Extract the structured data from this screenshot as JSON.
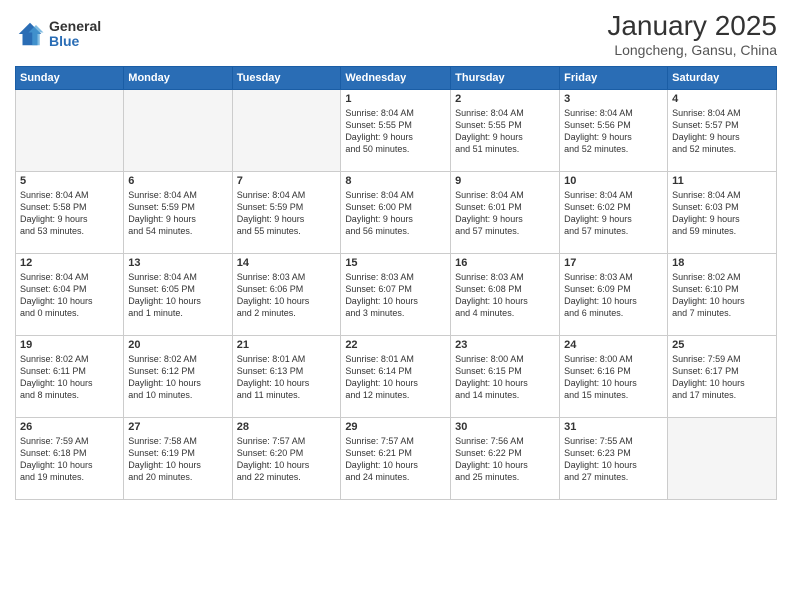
{
  "logo": {
    "general": "General",
    "blue": "Blue"
  },
  "header": {
    "month": "January 2025",
    "location": "Longcheng, Gansu, China"
  },
  "weekdays": [
    "Sunday",
    "Monday",
    "Tuesday",
    "Wednesday",
    "Thursday",
    "Friday",
    "Saturday"
  ],
  "weeks": [
    [
      {
        "num": "",
        "info": ""
      },
      {
        "num": "",
        "info": ""
      },
      {
        "num": "",
        "info": ""
      },
      {
        "num": "1",
        "info": "Sunrise: 8:04 AM\nSunset: 5:55 PM\nDaylight: 9 hours\nand 50 minutes."
      },
      {
        "num": "2",
        "info": "Sunrise: 8:04 AM\nSunset: 5:55 PM\nDaylight: 9 hours\nand 51 minutes."
      },
      {
        "num": "3",
        "info": "Sunrise: 8:04 AM\nSunset: 5:56 PM\nDaylight: 9 hours\nand 52 minutes."
      },
      {
        "num": "4",
        "info": "Sunrise: 8:04 AM\nSunset: 5:57 PM\nDaylight: 9 hours\nand 52 minutes."
      }
    ],
    [
      {
        "num": "5",
        "info": "Sunrise: 8:04 AM\nSunset: 5:58 PM\nDaylight: 9 hours\nand 53 minutes."
      },
      {
        "num": "6",
        "info": "Sunrise: 8:04 AM\nSunset: 5:59 PM\nDaylight: 9 hours\nand 54 minutes."
      },
      {
        "num": "7",
        "info": "Sunrise: 8:04 AM\nSunset: 5:59 PM\nDaylight: 9 hours\nand 55 minutes."
      },
      {
        "num": "8",
        "info": "Sunrise: 8:04 AM\nSunset: 6:00 PM\nDaylight: 9 hours\nand 56 minutes."
      },
      {
        "num": "9",
        "info": "Sunrise: 8:04 AM\nSunset: 6:01 PM\nDaylight: 9 hours\nand 57 minutes."
      },
      {
        "num": "10",
        "info": "Sunrise: 8:04 AM\nSunset: 6:02 PM\nDaylight: 9 hours\nand 57 minutes."
      },
      {
        "num": "11",
        "info": "Sunrise: 8:04 AM\nSunset: 6:03 PM\nDaylight: 9 hours\nand 59 minutes."
      }
    ],
    [
      {
        "num": "12",
        "info": "Sunrise: 8:04 AM\nSunset: 6:04 PM\nDaylight: 10 hours\nand 0 minutes."
      },
      {
        "num": "13",
        "info": "Sunrise: 8:04 AM\nSunset: 6:05 PM\nDaylight: 10 hours\nand 1 minute."
      },
      {
        "num": "14",
        "info": "Sunrise: 8:03 AM\nSunset: 6:06 PM\nDaylight: 10 hours\nand 2 minutes."
      },
      {
        "num": "15",
        "info": "Sunrise: 8:03 AM\nSunset: 6:07 PM\nDaylight: 10 hours\nand 3 minutes."
      },
      {
        "num": "16",
        "info": "Sunrise: 8:03 AM\nSunset: 6:08 PM\nDaylight: 10 hours\nand 4 minutes."
      },
      {
        "num": "17",
        "info": "Sunrise: 8:03 AM\nSunset: 6:09 PM\nDaylight: 10 hours\nand 6 minutes."
      },
      {
        "num": "18",
        "info": "Sunrise: 8:02 AM\nSunset: 6:10 PM\nDaylight: 10 hours\nand 7 minutes."
      }
    ],
    [
      {
        "num": "19",
        "info": "Sunrise: 8:02 AM\nSunset: 6:11 PM\nDaylight: 10 hours\nand 8 minutes."
      },
      {
        "num": "20",
        "info": "Sunrise: 8:02 AM\nSunset: 6:12 PM\nDaylight: 10 hours\nand 10 minutes."
      },
      {
        "num": "21",
        "info": "Sunrise: 8:01 AM\nSunset: 6:13 PM\nDaylight: 10 hours\nand 11 minutes."
      },
      {
        "num": "22",
        "info": "Sunrise: 8:01 AM\nSunset: 6:14 PM\nDaylight: 10 hours\nand 12 minutes."
      },
      {
        "num": "23",
        "info": "Sunrise: 8:00 AM\nSunset: 6:15 PM\nDaylight: 10 hours\nand 14 minutes."
      },
      {
        "num": "24",
        "info": "Sunrise: 8:00 AM\nSunset: 6:16 PM\nDaylight: 10 hours\nand 15 minutes."
      },
      {
        "num": "25",
        "info": "Sunrise: 7:59 AM\nSunset: 6:17 PM\nDaylight: 10 hours\nand 17 minutes."
      }
    ],
    [
      {
        "num": "26",
        "info": "Sunrise: 7:59 AM\nSunset: 6:18 PM\nDaylight: 10 hours\nand 19 minutes."
      },
      {
        "num": "27",
        "info": "Sunrise: 7:58 AM\nSunset: 6:19 PM\nDaylight: 10 hours\nand 20 minutes."
      },
      {
        "num": "28",
        "info": "Sunrise: 7:57 AM\nSunset: 6:20 PM\nDaylight: 10 hours\nand 22 minutes."
      },
      {
        "num": "29",
        "info": "Sunrise: 7:57 AM\nSunset: 6:21 PM\nDaylight: 10 hours\nand 24 minutes."
      },
      {
        "num": "30",
        "info": "Sunrise: 7:56 AM\nSunset: 6:22 PM\nDaylight: 10 hours\nand 25 minutes."
      },
      {
        "num": "31",
        "info": "Sunrise: 7:55 AM\nSunset: 6:23 PM\nDaylight: 10 hours\nand 27 minutes."
      },
      {
        "num": "",
        "info": ""
      }
    ]
  ]
}
